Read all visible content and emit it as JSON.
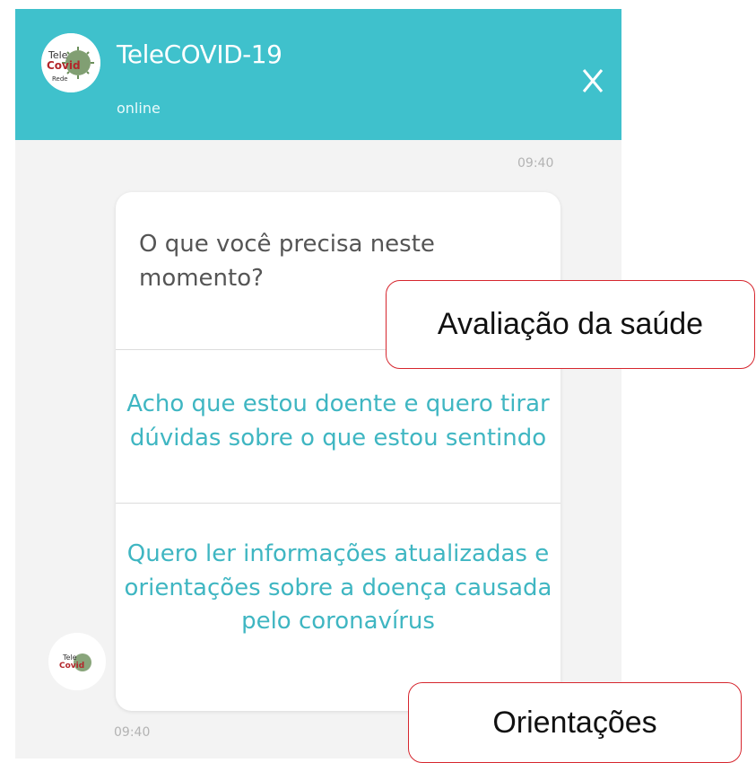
{
  "header": {
    "title": "TeleCOVID-19",
    "status": "online",
    "close_label": "X",
    "brand_color": "#3fc1cc",
    "logo_text": "TeleCovid19"
  },
  "messages": {
    "timestamp_top": "09:40",
    "timestamp_bottom": "09:40",
    "question": "O que você precisa neste momento?",
    "options": [
      "Acho que estou doente e quero tirar dúvidas sobre o que estou sentindo",
      "Quero ler informações atualizadas e orientações sobre a doença causada pelo coronavírus"
    ],
    "option_color": "#3fb6c2"
  },
  "annotations": {
    "callout_1": "Avaliação da saúde",
    "callout_2": "Orientações",
    "border_color": "#d6262e"
  }
}
